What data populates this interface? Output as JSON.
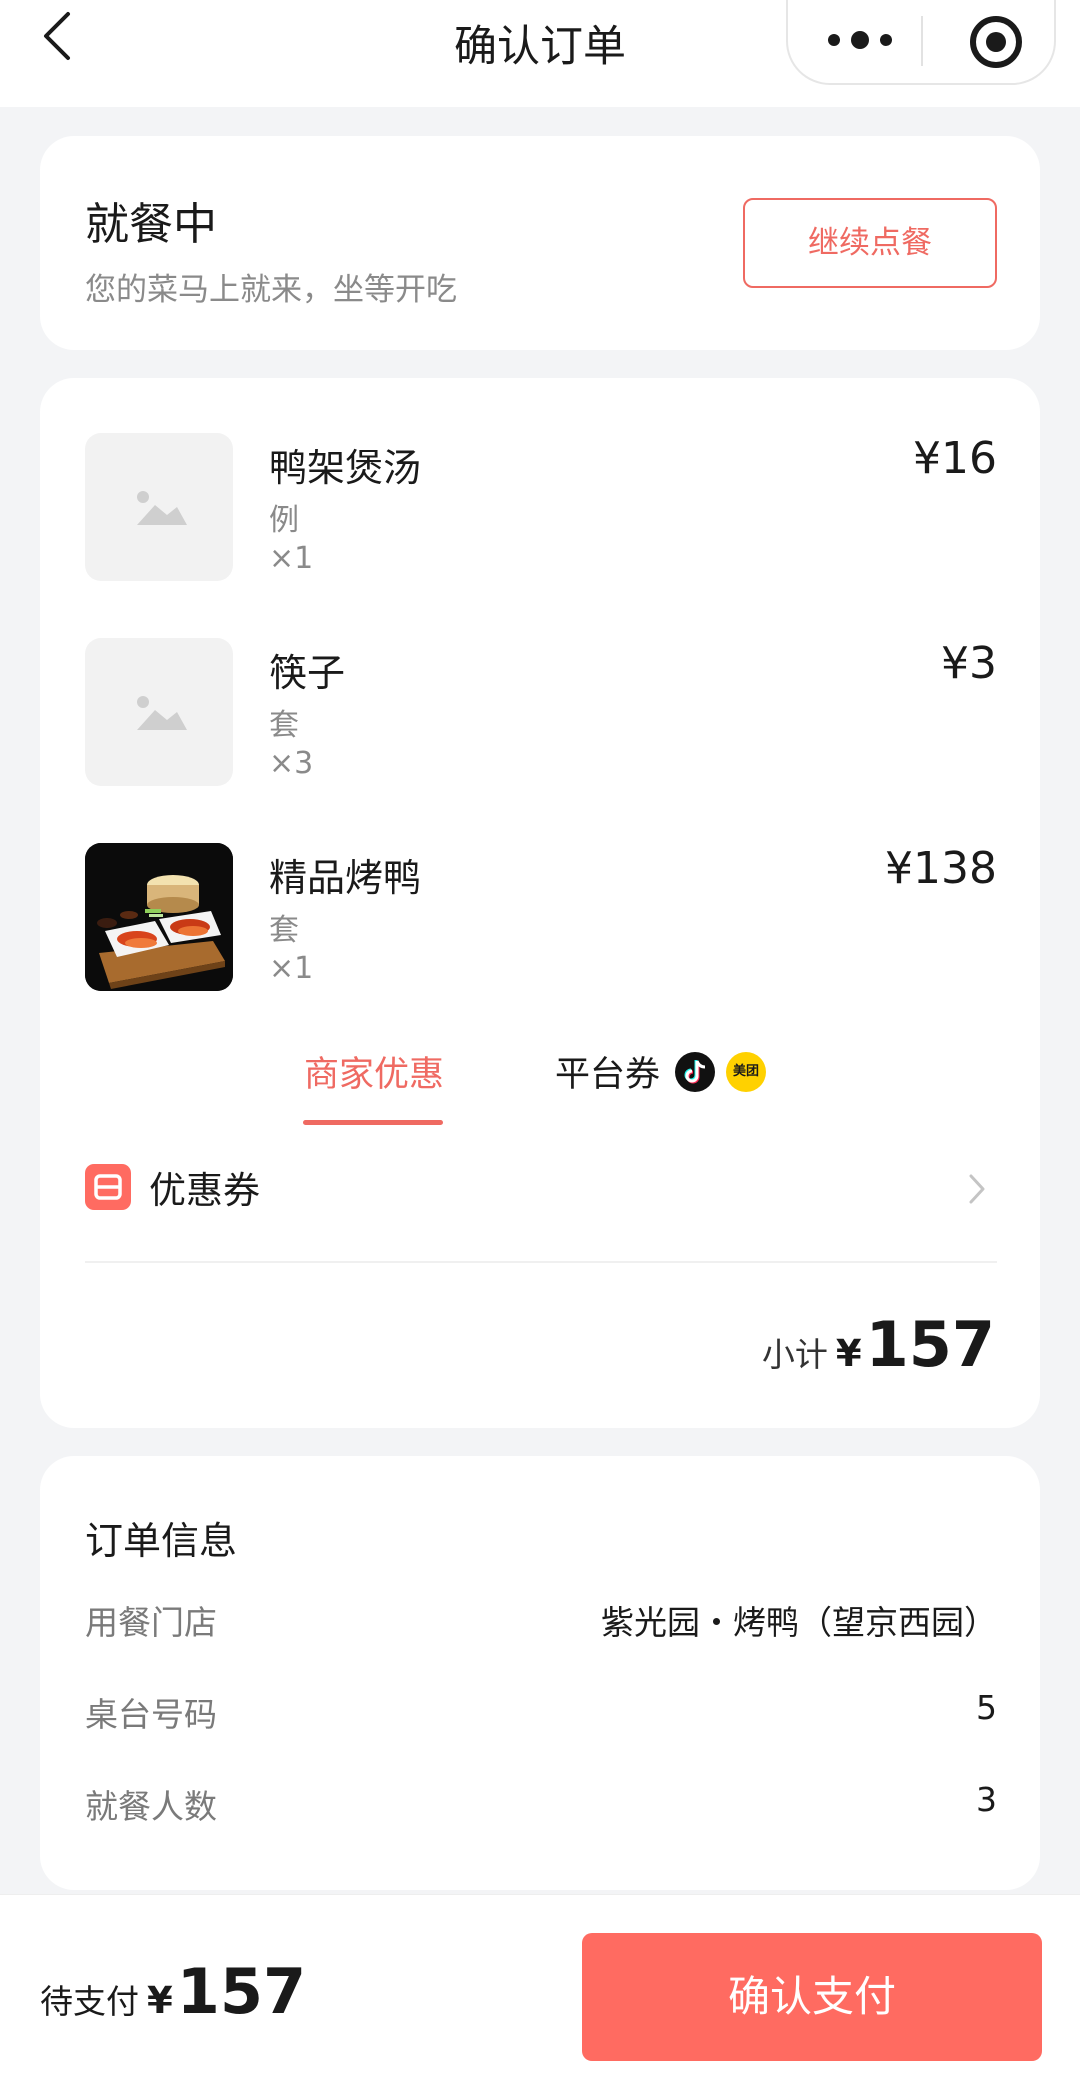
{
  "header": {
    "title": "确认订单",
    "back_icon": "chevron-left-icon",
    "more_icon": "more-dots-icon",
    "close_icon": "target-circle-icon"
  },
  "status": {
    "title": "就餐中",
    "subtitle": "您的菜马上就来，坐等开吃",
    "continue_label": "继续点餐"
  },
  "items": [
    {
      "name": "鸭架煲汤",
      "unit": "例",
      "qty": "×1",
      "price": "¥16",
      "image": "placeholder-image-icon"
    },
    {
      "name": "筷子",
      "unit": "套",
      "qty": "×3",
      "price": "¥3",
      "image": "placeholder-image-icon"
    },
    {
      "name": "精品烤鸭",
      "unit": "套",
      "qty": "×1",
      "price": "¥138",
      "image": "roast-duck-photo"
    }
  ],
  "tabs": {
    "merchant": "商家优惠",
    "platform": "平台券",
    "meituan_badge": "美团"
  },
  "coupon": {
    "label": "优惠券"
  },
  "subtotal": {
    "label": "小计",
    "currency": "¥",
    "amount": "157"
  },
  "order_info": {
    "title": "订单信息",
    "rows": [
      {
        "label": "用餐门店",
        "value": "紫光园・烤鸭（望京西园）"
      },
      {
        "label": "桌台号码",
        "value": "5"
      },
      {
        "label": "就餐人数",
        "value": "3"
      }
    ]
  },
  "footer": {
    "pending_label": "待支付",
    "currency": "¥",
    "amount": "157",
    "pay_label": "确认支付"
  },
  "colors": {
    "accent": "#ef6a62",
    "pay_button": "#ff6b61",
    "background": "#f3f4f6",
    "meituan_yellow": "#ffd100"
  }
}
